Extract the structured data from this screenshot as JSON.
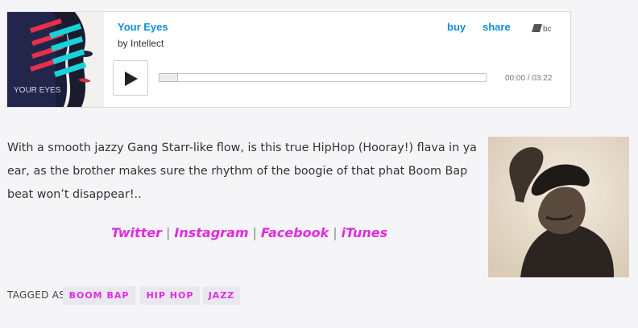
{
  "player": {
    "track_title": "Your Eyes",
    "artist": "by Intellect",
    "buy_label": "buy",
    "share_label": "share",
    "logo_text": "bc",
    "cover_text": "YOUR EYES",
    "time": "00:00 / 03:22",
    "progress_fraction": 0,
    "accent_color": "#0f8fd6"
  },
  "article": {
    "description": "With a smooth jazzy Gang Starr-like flow, is this true HipHop (Hooray!) flava in ya ear, as the brother makes sure the rhythm of the boogie of that phat Boom Bap beat won’t disappear!..",
    "links": [
      {
        "label": "Twitter"
      },
      {
        "label": "Instagram"
      },
      {
        "label": "Facebook"
      },
      {
        "label": "iTunes"
      }
    ],
    "separator": "|",
    "link_color": "#e22be2"
  },
  "tags": {
    "label": "TAGGED AS",
    "items": [
      "BOOM BAP",
      "HIP HOP",
      "JAZZ"
    ]
  }
}
